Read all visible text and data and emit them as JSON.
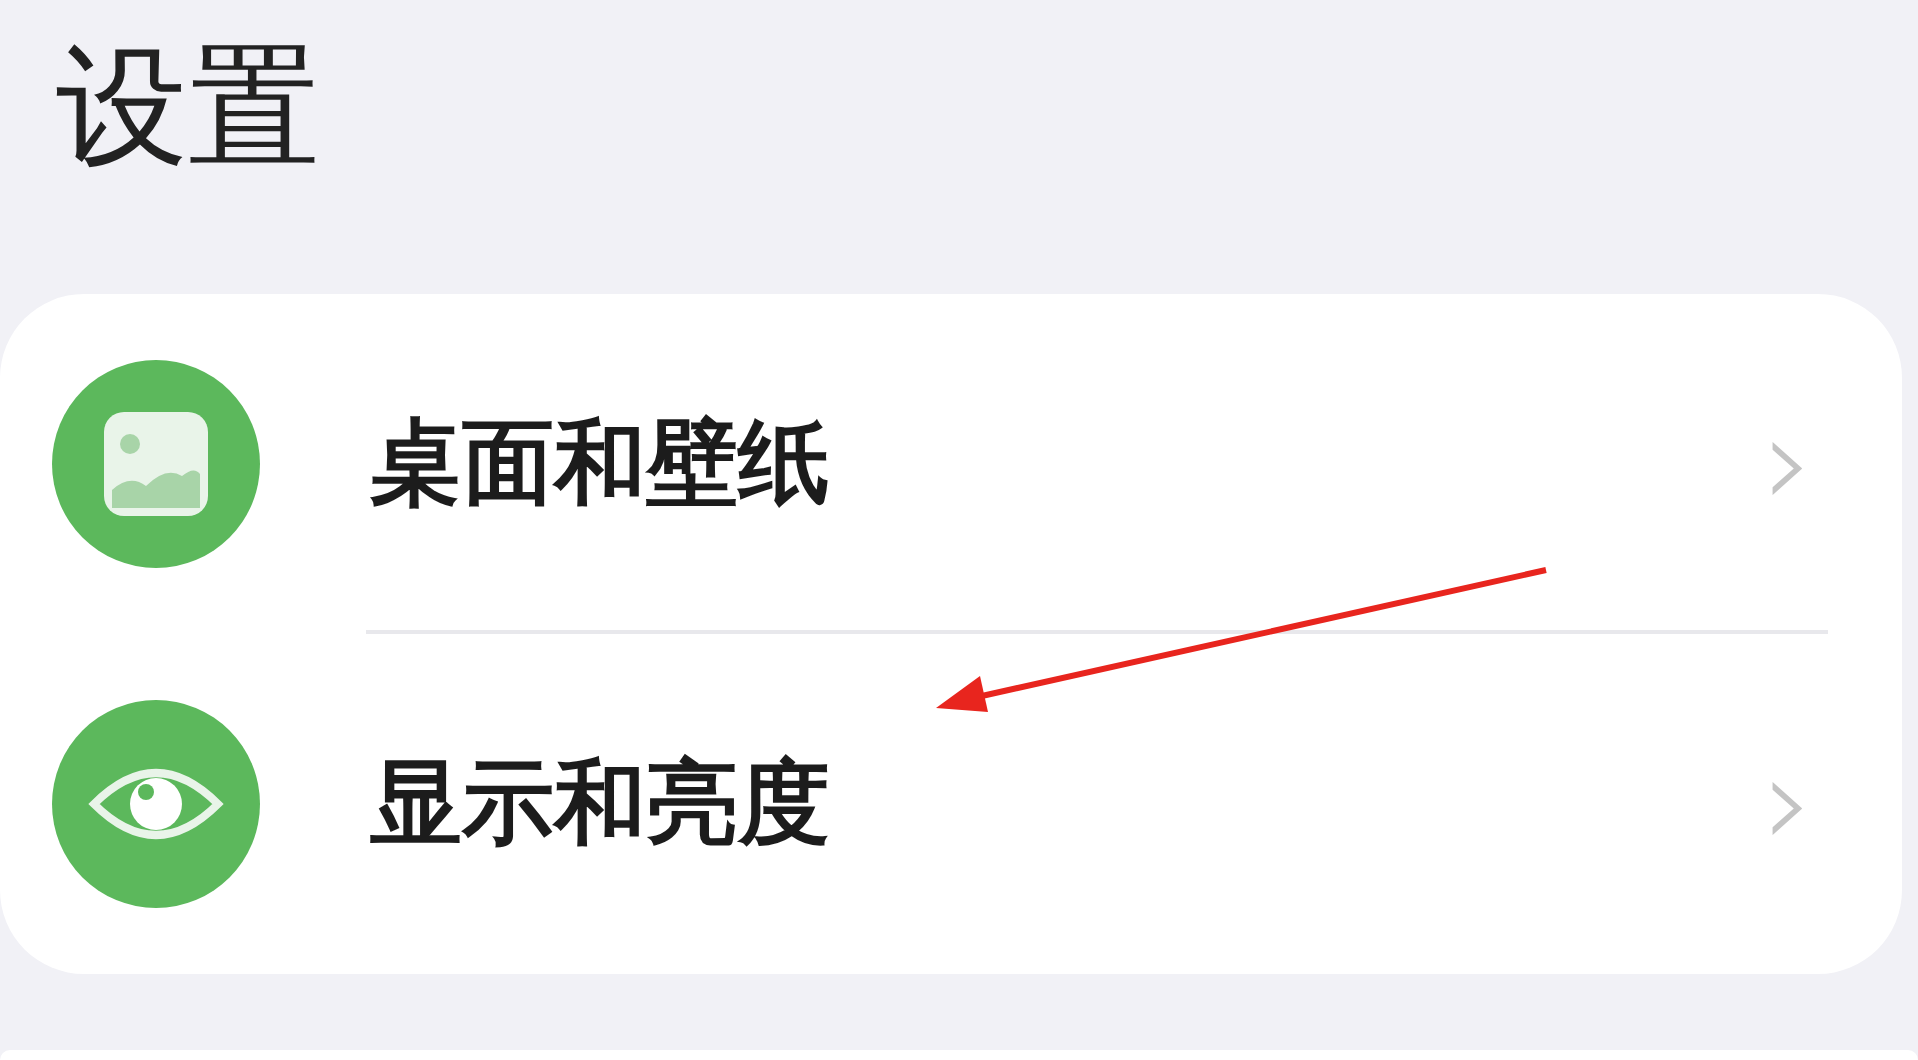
{
  "title": "设置",
  "items": [
    {
      "label": "桌面和壁纸",
      "kind": "picture",
      "chevron": "›"
    },
    {
      "label": "显示和亮度",
      "kind": "eye",
      "chevron": "›"
    }
  ]
}
